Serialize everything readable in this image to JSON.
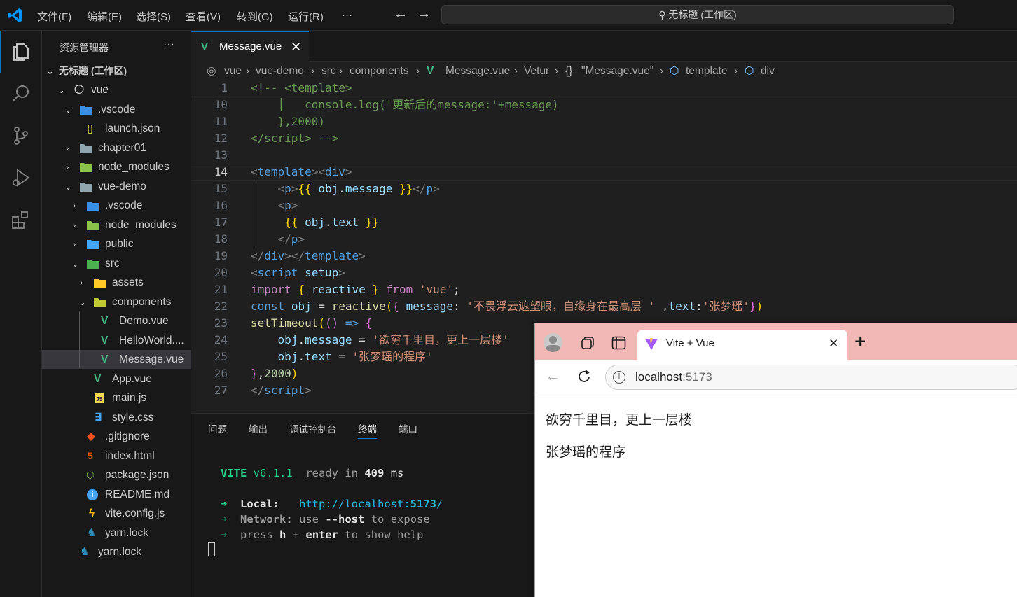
{
  "titlebar": {
    "menus": [
      "文件(F)",
      "编辑(E)",
      "选择(S)",
      "查看(V)",
      "转到(G)",
      "运行(R)",
      "···"
    ],
    "search": "无标题 (工作区)"
  },
  "sidebar": {
    "title": "资源管理器",
    "more": "···",
    "workspace": "无标题 (工作区)",
    "items": [
      {
        "label": "vue"
      },
      {
        "label": ".vscode"
      },
      {
        "label": "launch.json"
      },
      {
        "label": "chapter01"
      },
      {
        "label": "node_modules"
      },
      {
        "label": "vue-demo"
      },
      {
        "label": ".vscode"
      },
      {
        "label": "node_modules"
      },
      {
        "label": "public"
      },
      {
        "label": "src"
      },
      {
        "label": "assets"
      },
      {
        "label": "components"
      },
      {
        "label": "Demo.vue"
      },
      {
        "label": "HelloWorld...."
      },
      {
        "label": "Message.vue"
      },
      {
        "label": "App.vue"
      },
      {
        "label": "main.js"
      },
      {
        "label": "style.css"
      },
      {
        "label": ".gitignore"
      },
      {
        "label": "index.html"
      },
      {
        "label": "package.json"
      },
      {
        "label": "README.md"
      },
      {
        "label": "vite.config.js"
      },
      {
        "label": "yarn.lock"
      },
      {
        "label": "yarn.lock"
      }
    ]
  },
  "editor": {
    "tab": "Message.vue",
    "breadcrumbs": [
      "vue",
      "vue-demo",
      "src",
      "components",
      "Message.vue",
      "Vetur",
      "\"Message.vue\"",
      "template",
      "div"
    ],
    "line_numbers": [
      "1",
      "10",
      "11",
      "12",
      "13",
      "14",
      "15",
      "16",
      "17",
      "18",
      "19",
      "20",
      "21",
      "22",
      "23",
      "24",
      "25",
      "26",
      "27"
    ]
  },
  "panel": {
    "tabs": [
      "问题",
      "输出",
      "调试控制台",
      "终端",
      "端口"
    ],
    "vite_name": "VITE",
    "vite_version": "v6.1.1",
    "ready": "ready in",
    "ms_value": "409",
    "ms": "ms",
    "local_label": "Local:",
    "local_url_a": "http://localhost:",
    "local_url_port": "5173",
    "local_url_b": "/",
    "network_label": "Network:",
    "network_text_a": "use",
    "network_flag": "--host",
    "network_text_b": "to expose",
    "press": "press",
    "key_h": "h",
    "plus": "+",
    "key_enter": "enter",
    "help": "to show help"
  },
  "browser": {
    "tab_title": "Vite + Vue",
    "url_host": "localhost",
    "url_port": ":5173",
    "p1": "欲穷千里目，更上一层楼",
    "p2": "张梦瑶的程序"
  }
}
